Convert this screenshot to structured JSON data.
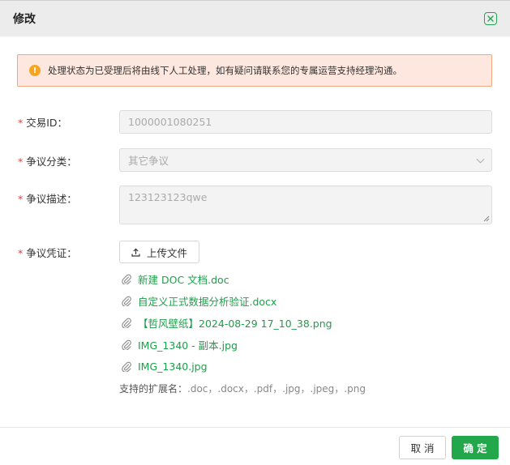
{
  "dialog": {
    "title": "修改",
    "close_icon": "close-icon"
  },
  "notice": {
    "icon": "warning-icon",
    "text": "处理状态为已受理后将由线下人工处理，如有疑问请联系您的专属运营支持经理沟通。"
  },
  "form": {
    "required_mark": "*",
    "trade_id": {
      "label": "交易ID：",
      "value": "1000001080251"
    },
    "category": {
      "label": "争议分类：",
      "value": "其它争议"
    },
    "description": {
      "label": "争议描述：",
      "value": "123123123qwe"
    },
    "evidence": {
      "label": "争议凭证：",
      "upload_label": "上传文件",
      "files": [
        "新建 DOC 文档.doc",
        "自定义正式数据分析验证.docx",
        "【哲风壁纸】2024-08-29 17_10_38.png",
        "IMG_1340 - 副本.jpg",
        "IMG_1340.jpg"
      ],
      "hint_label": "支持的扩展名：",
      "hint_exts": ".doc，.docx，.pdf，.jpg，.jpeg，.png"
    }
  },
  "footer": {
    "cancel_label": "取 消",
    "ok_label": "确 定"
  },
  "colors": {
    "accent": "#22a84a",
    "link": "#1e9e4a",
    "warning": "#f5a623",
    "required": "#e03c3c"
  }
}
